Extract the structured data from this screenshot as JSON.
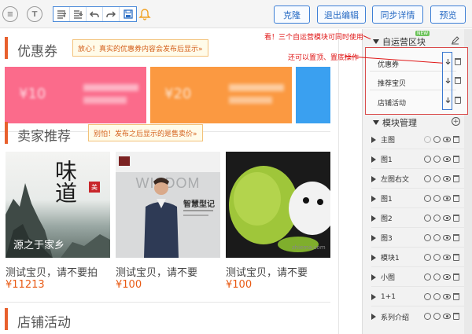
{
  "toolbar": {
    "buttons": {
      "clone": "克隆",
      "exit_edit": "退出编辑",
      "sync_detail": "同步详情",
      "preview": "预览"
    }
  },
  "main": {
    "coupon_section": {
      "title": "优惠券",
      "tip": "放心！真实的优惠券内容会发布后显示»",
      "coupons": [
        {
          "amount": "¥10",
          "color": "#fb6b8b"
        },
        {
          "amount": "¥20",
          "color": "#fb9941"
        },
        {
          "amount": "",
          "color": "#3aa0f0"
        }
      ]
    },
    "recommend_section": {
      "title": "卖家推荐",
      "tip": "别怕！发布之后显示的是售卖价»",
      "products": [
        {
          "image_text": "味道",
          "image_seal": "美",
          "image_caption": "源之于家乡",
          "name": "测试宝贝，请不要拍",
          "price": "¥11213"
        },
        {
          "image_text": "WISDOM",
          "image_subtext": "智慧型记",
          "name": "测试宝贝，请不要",
          "price": "¥100"
        },
        {
          "image_text": "",
          "image_watermark": "zhiema.com",
          "name": "测试宝贝，请不要",
          "price": "¥100"
        }
      ]
    },
    "activity_section": {
      "title": "店铺活动"
    }
  },
  "annotations": {
    "line1": "看！三个自运营模块可同时使用",
    "line2": "还可以置顶、置底操作"
  },
  "panel": {
    "custom_header": "自运营区块",
    "new_badge": "NEW",
    "custom_items": [
      "优惠券",
      "推荐宝贝",
      "店铺活动"
    ],
    "module_header": "模块管理",
    "modules": [
      "主图",
      "图1",
      "左图右文",
      "图1",
      "图2",
      "图3",
      "模块1",
      "小图",
      "1+1",
      "系列介绍"
    ]
  },
  "colors": {
    "accent_orange": "#e8602d",
    "price_orange": "#e85a14",
    "button_blue": "#3d7fd6",
    "annotation_red": "#e01818"
  }
}
